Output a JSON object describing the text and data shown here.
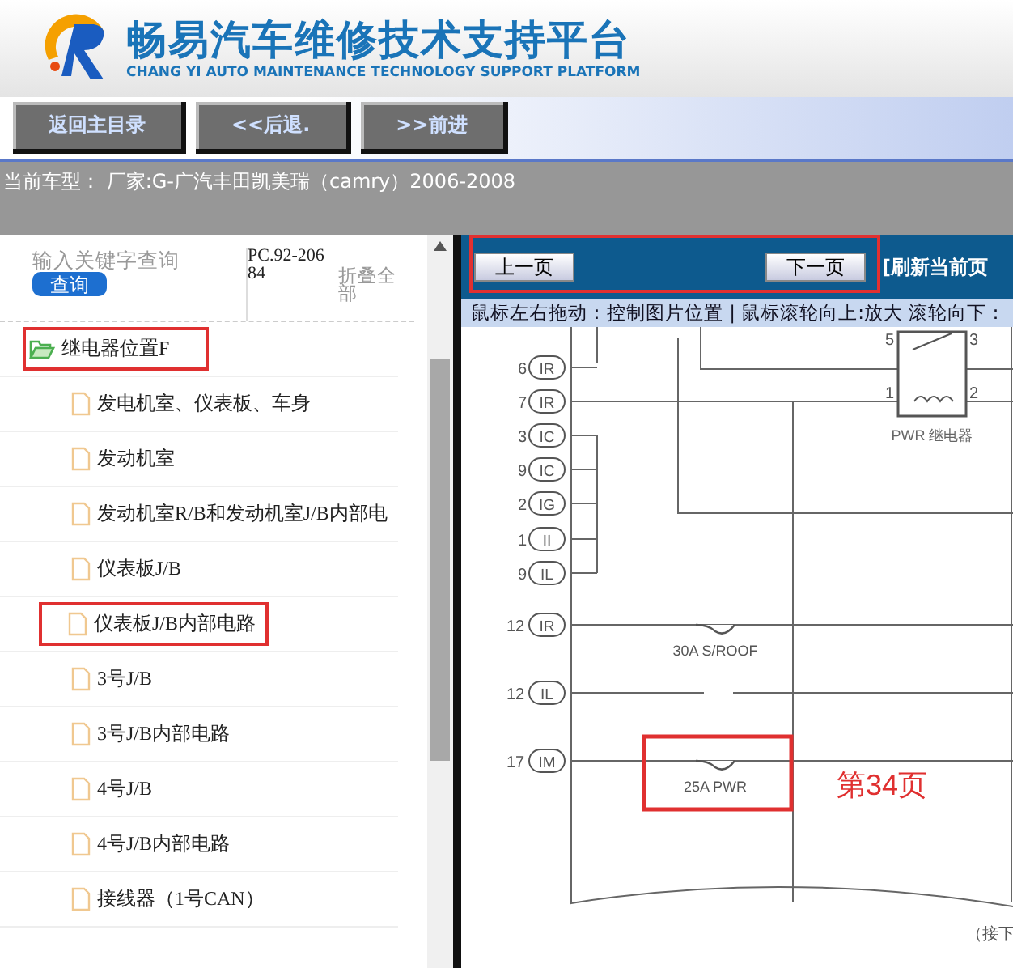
{
  "header": {
    "title": "畅易汽车维修技术支持平台",
    "subtitle": "CHANG YI AUTO MAINTENANCE TECHNOLOGY SUPPORT PLATFORM"
  },
  "toolbar": {
    "buttons": [
      "返回主目录",
      "<<后退.",
      ">>前进"
    ]
  },
  "model_bar": {
    "text": "当前车型：  厂家:G-广汽丰田凯美瑞（camry）2006-2008"
  },
  "sidebar": {
    "search": {
      "placeholder": "输入关键字查询",
      "button": "查询"
    },
    "code": "PC.92-20684",
    "collapse": "折叠全部",
    "tree": [
      {
        "label": "继电器位置F",
        "expanded": true,
        "highlighted": true,
        "children": [
          {
            "label": "发电机室、仪表板、车身",
            "highlighted": false
          },
          {
            "label": "发动机室",
            "highlighted": false
          },
          {
            "label": "发动机室R/B和发动机室J/B内部电",
            "highlighted": false
          },
          {
            "label": "仪表板J/B",
            "highlighted": false
          },
          {
            "label": "仪表板J/B内部电路",
            "highlighted": true
          },
          {
            "label": "3号J/B",
            "highlighted": false
          },
          {
            "label": "3号J/B内部电路",
            "highlighted": false
          },
          {
            "label": "4号J/B",
            "highlighted": false
          },
          {
            "label": "4号J/B内部电路",
            "highlighted": false
          },
          {
            "label": "接线器（1号CAN）",
            "highlighted": false
          }
        ]
      }
    ]
  },
  "viewer": {
    "prev": "上一页",
    "next": "下一页",
    "nav_highlighted": true,
    "refresh": "[刷新当前页",
    "hint": "鼠标左右拖动：控制图片位置 | 鼠标滚轮向上:放大   滚轮向下：",
    "diagram": {
      "pins": [
        {
          "number": "6",
          "code": "IR"
        },
        {
          "number": "7",
          "code": "IR"
        },
        {
          "number": "3",
          "code": "IC"
        },
        {
          "number": "9",
          "code": "IC"
        },
        {
          "number": "2",
          "code": "IG"
        },
        {
          "number": "1",
          "code": "II"
        },
        {
          "number": "9",
          "code": "IL"
        },
        {
          "number": "12",
          "code": "IR"
        },
        {
          "number": "12",
          "code": "IL"
        },
        {
          "number": "17",
          "code": "IM"
        }
      ],
      "relay": {
        "label": "PWR 继电器",
        "terminals": [
          "5",
          "3",
          "1",
          "2"
        ]
      },
      "fuses": [
        {
          "label": "30A S/ROOF",
          "highlighted": false
        },
        {
          "label": "25A PWR",
          "highlighted": true
        }
      ],
      "continuation": "（接下",
      "annotation": "第34页"
    }
  }
}
